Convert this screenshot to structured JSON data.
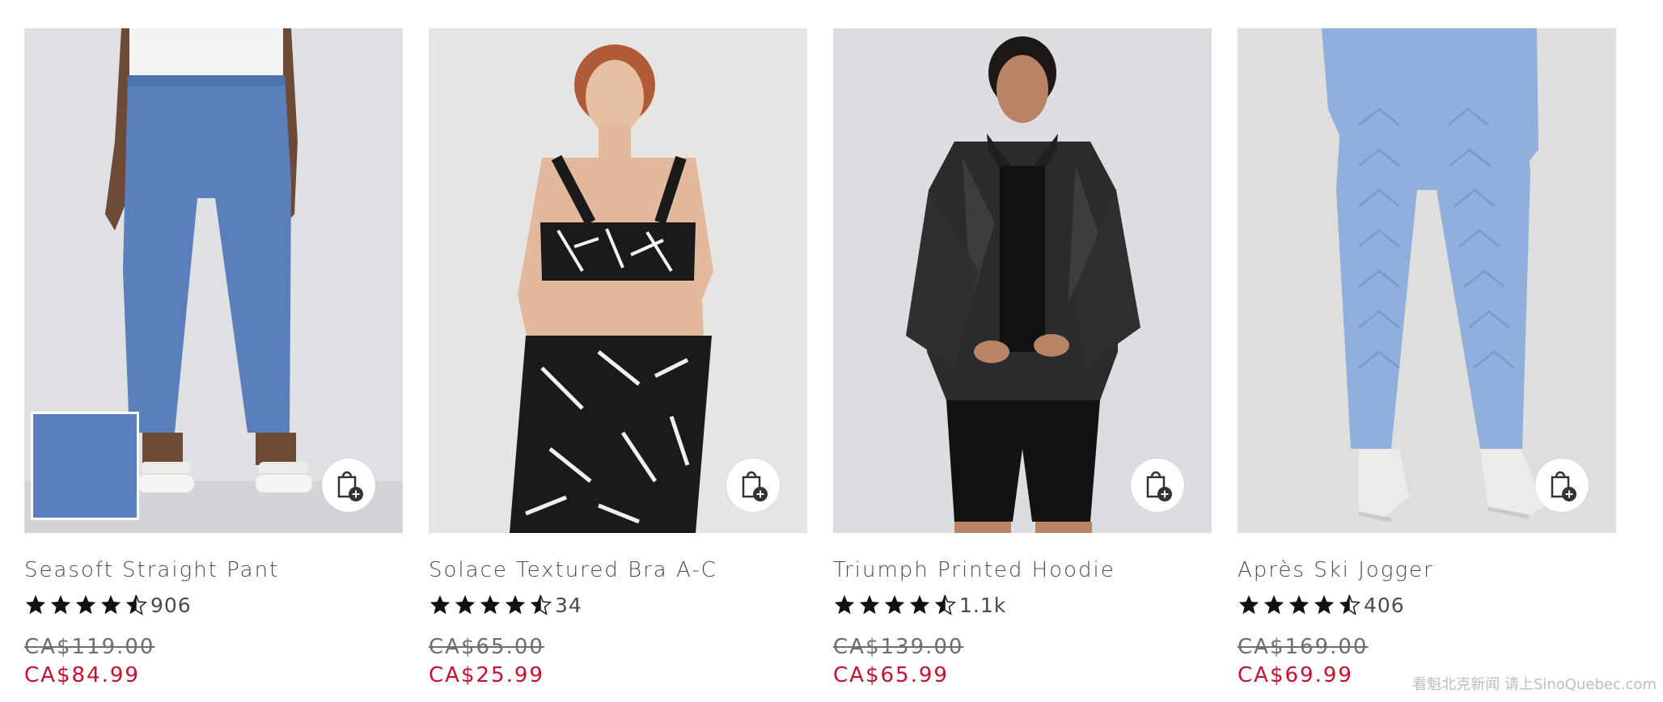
{
  "products": [
    {
      "name": "Seasoft Straight Pant",
      "rating": 4.5,
      "reviews": "906",
      "price_original": "CA$119.00",
      "price_sale": "CA$84.99",
      "swatch_color": "#5b80bd",
      "garment_color": "#5a7fba",
      "bg_color": "#dfe0e3"
    },
    {
      "name": "Solace Textured Bra A-C",
      "rating": 4.5,
      "reviews": "34",
      "price_original": "CA$65.00",
      "price_sale": "CA$25.99",
      "garment_color": "#1a1a1a",
      "bg_color": "#e7e5e3"
    },
    {
      "name": "Triumph Printed Hoodie",
      "rating": 4.5,
      "reviews": "1.1k",
      "price_original": "CA$139.00",
      "price_sale": "CA$65.99",
      "garment_color": "#2b2b2b",
      "bg_color": "#dcdde0"
    },
    {
      "name": "Après Ski Jogger",
      "rating": 4.5,
      "reviews": "406",
      "price_original": "CA$169.00",
      "price_sale": "CA$69.99",
      "garment_color": "#8fb0dc",
      "bg_color": "#dfdedc"
    }
  ],
  "icons": {
    "add_to_bag": "shopping-bag-plus-icon",
    "star": "star-icon"
  },
  "colors": {
    "sale_price": "#c8102e",
    "text": "#4a4a4a",
    "strike_price": "#6e6e6e"
  },
  "watermark": "看魁北克新闻 请上SinoQuebec.com"
}
